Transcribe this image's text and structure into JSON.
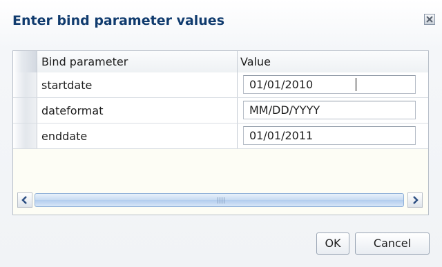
{
  "dialog": {
    "title": "Enter bind parameter values",
    "close_icon": "close-icon"
  },
  "grid": {
    "columns": [
      "Bind parameter",
      "Value"
    ],
    "rows": [
      {
        "name": "startdate",
        "value": "01/01/2010"
      },
      {
        "name": "dateformat",
        "value": "MM/DD/YYYY"
      },
      {
        "name": "enddate",
        "value": "01/01/2011"
      }
    ]
  },
  "scrollbar": {
    "left_icon": "arrow-left-icon",
    "right_icon": "arrow-right-icon",
    "grip_icon": "grip-icon"
  },
  "buttons": {
    "ok_label": "OK",
    "cancel_label": "Cancel"
  }
}
